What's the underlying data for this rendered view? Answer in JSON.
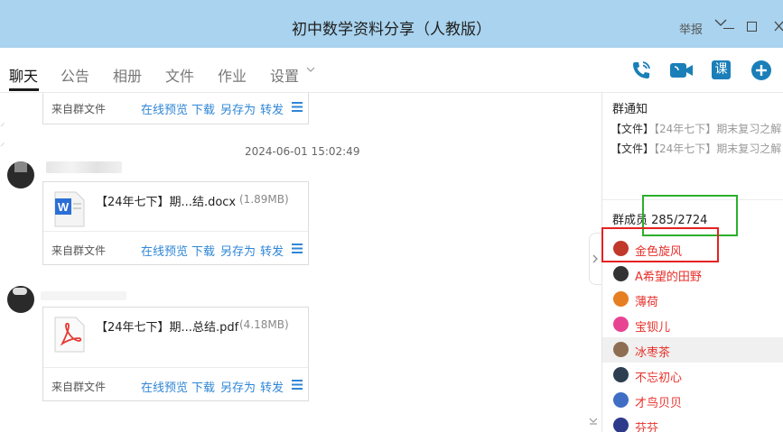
{
  "window": {
    "title": "初中数学资料分享（人教版）",
    "report_label": "举报"
  },
  "tabs": [
    {
      "label": "聊天",
      "active": true
    },
    {
      "label": "公告"
    },
    {
      "label": "相册"
    },
    {
      "label": "文件"
    },
    {
      "label": "作业"
    },
    {
      "label": "设置"
    }
  ],
  "toolbar": {
    "icons": [
      "phone-icon",
      "video-icon",
      "class-icon",
      "add-icon"
    ],
    "class_label": "课",
    "accent": "#1a7fb8"
  },
  "chat": {
    "timestamp": "2024-06-01 15:02:49",
    "card_actions": [
      "在线预览",
      "下载",
      "另存为",
      "转发"
    ],
    "from_label": "来自群文件",
    "files": [
      {
        "name": "【24年七下】期...结.docx",
        "size": "(1.89MB)",
        "type": "word"
      },
      {
        "name": "【24年七下】期...总结.pdf",
        "size": "(4.18MB)",
        "type": "pdf"
      }
    ],
    "colors": {
      "link": "#2f86d6"
    }
  },
  "sidebar": {
    "notice_title": "群通知",
    "notices": [
      {
        "tag": "【文件】",
        "text": "【24年七下】期末复习之解"
      },
      {
        "tag": "【文件】",
        "text": "【24年七下】期末复习之解"
      }
    ],
    "members_title": "群成员 285/2724",
    "members": [
      {
        "name": "金色旋风",
        "avatar_color": "#c0392b"
      },
      {
        "name": "A希望的田野",
        "avatar_color": "#333333"
      },
      {
        "name": "薄荷",
        "avatar_color": "#e67e22"
      },
      {
        "name": "宝钡儿",
        "avatar_color": "#e84393"
      },
      {
        "name": "冰枣茶",
        "avatar_color": "#8e6e53",
        "highlighted": true
      },
      {
        "name": "不忘初心",
        "avatar_color": "#2c3e50"
      },
      {
        "name": "才鸟贝贝",
        "avatar_color": "#3f6ec4"
      },
      {
        "name": "芬芬",
        "avatar_color": "#2d3a8c"
      }
    ],
    "member_name_color": "#e8302a"
  }
}
